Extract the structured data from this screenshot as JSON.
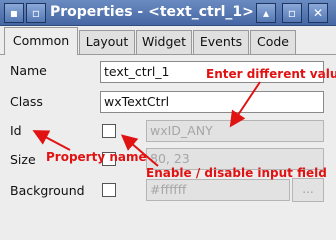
{
  "window": {
    "title": "Properties - <text_ctrl_1>",
    "icon": "window-menu-icon",
    "controls": [
      "roll-up-icon",
      "maximize-icon",
      "close-icon"
    ]
  },
  "tabs": [
    {
      "label": "Common",
      "active": true
    },
    {
      "label": "Layout"
    },
    {
      "label": "Widget"
    },
    {
      "label": "Events"
    },
    {
      "label": "Code"
    }
  ],
  "properties": {
    "name": {
      "label": "Name",
      "value": "text_ctrl_1"
    },
    "class": {
      "label": "Class",
      "value": "wxTextCtrl"
    },
    "id": {
      "label": "Id",
      "value": "wxID_ANY",
      "enabled": false
    },
    "size": {
      "label": "Size",
      "value": "80, 23",
      "enabled": false
    },
    "background": {
      "label": "Background",
      "value": "#ffffff",
      "enabled": false,
      "button": "..."
    }
  },
  "annotations": {
    "value_note": "Enter different value",
    "property_note": "Property name",
    "toggle_note": "Enable / disable input field"
  },
  "colors": {
    "titlebar": "#4f70ac",
    "annotation": "#e01212"
  }
}
